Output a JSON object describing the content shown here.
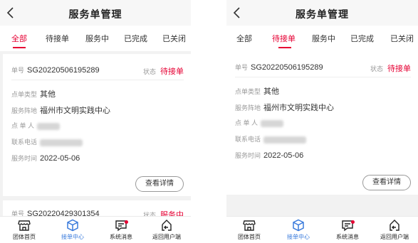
{
  "header": {
    "title": "服务单管理"
  },
  "tabs": [
    "全部",
    "待接单",
    "服务中",
    "已完成",
    "已关闭"
  ],
  "labels": {
    "order_no": "单号",
    "status": "状态",
    "order_type": "点单类型",
    "position": "服务阵地",
    "orderer": "点 单 人",
    "phone": "联系电话",
    "service_time": "服务时间"
  },
  "orders": [
    {
      "order_no": "SG20220506195289",
      "status": "待接单",
      "order_type": "其他",
      "position": "福州市文明实践中心",
      "service_time": "2022-05-06",
      "detail_button": "查看详情"
    },
    {
      "order_no": "SG20220429301354",
      "status": "服务中"
    }
  ],
  "tabbar": [
    {
      "label": "团体首页",
      "icon": "storefront-icon"
    },
    {
      "label": "接单中心",
      "icon": "cube-icon"
    },
    {
      "label": "系统消息",
      "icon": "message-icon"
    },
    {
      "label": "返回用户端",
      "icon": "return-home-icon"
    }
  ],
  "colors": {
    "accent": "#e60033",
    "active_tab_icon": "#3a7bdc"
  }
}
